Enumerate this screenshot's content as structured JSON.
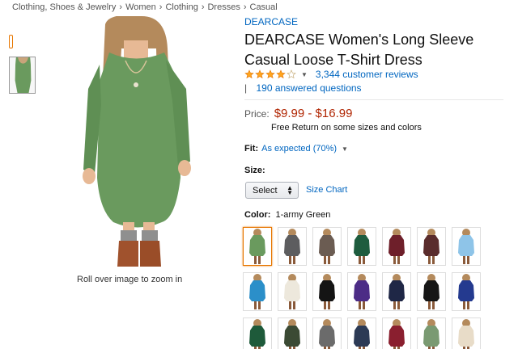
{
  "breadcrumb": [
    "Clothing, Shoes & Jewelry",
    "Women",
    "Clothing",
    "Dresses",
    "Casual"
  ],
  "breadcrumb_separator": "›",
  "zoom_hint": "Roll over image to zoom in",
  "product": {
    "brand": "DEARCASE",
    "title": "DEARCASE Women's Long Sleeve Casual Loose T-Shirt Dress",
    "rating": 4,
    "rating_max": 5,
    "reviews": "3,344 customer reviews",
    "pipe": "|",
    "answered": "190 answered questions",
    "price_label": "Price:",
    "price": "$9.99 - $16.99",
    "free_return": "Free Return on some sizes and colors",
    "fit_label": "Fit:",
    "fit_value": "As expected (70%)",
    "size_label": "Size:",
    "size_select": "Select",
    "size_chart": "Size Chart",
    "color_label": "Color:",
    "color_value": "1-army Green",
    "dress_color": "#6a9a5e"
  },
  "colors": {
    "link": "#0066c0",
    "price": "#b12704",
    "star": "#ffa41c",
    "selected_border": "#e77600"
  },
  "swatches": [
    "#6a9a5e",
    "#5d5d5f",
    "#6b5c52",
    "#1e5c3e",
    "#6e1f2a",
    "#5a2c2c",
    "#8ec4e8",
    "#2b8fc9",
    "#ede8dc",
    "#141414",
    "#4c2c86",
    "#1f2746",
    "#161616",
    "#243a8f",
    "#1e5a3a",
    "#3b4a34",
    "#6b6b6b",
    "#2c3a55",
    "#8a1f2f",
    "#7a9a72",
    "#e8dcc8"
  ],
  "selected_swatch": 0
}
